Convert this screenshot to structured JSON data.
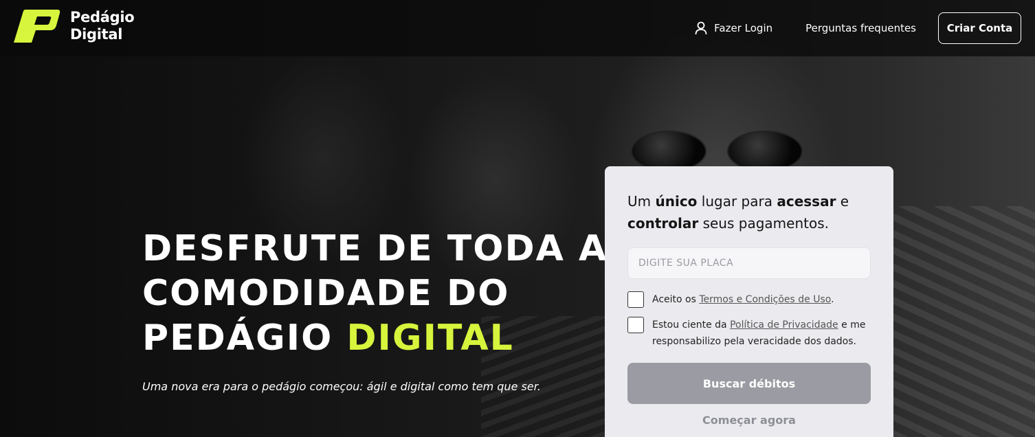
{
  "brand": {
    "name_line1": "Pedágio",
    "name_line2": "Digital",
    "accent_color": "#d6f53c"
  },
  "nav": {
    "login_label": "Fazer Login",
    "login_icon": "user-icon",
    "faq_label": "Perguntas frequentes",
    "cta_label": "Criar Conta"
  },
  "hero": {
    "headline_line1": "DESFRUTE DE TODA A",
    "headline_line2": "COMODIDADE DO",
    "headline_line3_prefix": "PEDÁGIO",
    "headline_line3_accent": "DIGITAL",
    "subline": "Uma nova era para o pedágio começou: ágil e digital como tem que ser."
  },
  "form": {
    "title_part1": "Um",
    "title_bold1": "único",
    "title_part2": "lugar para",
    "title_bold2": "acessar",
    "title_part3": "e",
    "title_bold3": "controlar",
    "title_part4": "seus pagamentos.",
    "plate_placeholder": "DIGITE SUA PLACA",
    "plate_value": "",
    "terms_prefix": "Aceito os",
    "terms_link": "Termos e Condições de Uso",
    "terms_suffix": ".",
    "privacy_prefix": "Estou ciente da",
    "privacy_link": "Política de Privacidade",
    "privacy_suffix": "e me responsabilizo pela veracidade dos dados.",
    "search_button": "Buscar débitos",
    "start_link": "Começar agora"
  }
}
